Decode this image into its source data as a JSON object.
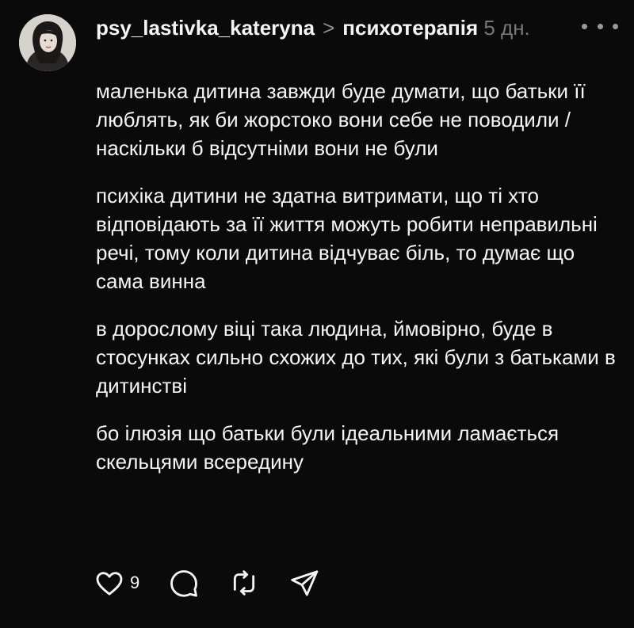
{
  "post": {
    "username": "psy_lastivka_kateryna",
    "separator": ">",
    "topic": "психотерапія",
    "time": "5 дн.",
    "paragraphs": [
      "маленька дитина завжди буде думати, що батьки її люблять, як би жорстоко вони себе не поводили / наскільки б відсутніми вони не були",
      "психіка дитини не здатна витримати, що ті хто відповідають за її життя можуть робити неправильні речі, тому коли дитина відчуває біль, то думає що сама винна",
      "в дорослому віці така людина, ймовірно, буде в стосунках сильно схожих до тих, які були з батьками в дитинстві",
      "бо ілюзія що батьки були ідеальними ламається скельцями всередину"
    ],
    "like_count": "9"
  },
  "icons": {
    "avatar": "profile-photo",
    "more": "more-horizontal-icon",
    "like": "heart-icon",
    "reply": "comment-bubble-icon",
    "repost": "repost-icon",
    "share": "send-icon"
  },
  "colors": {
    "background": "#0a0a0a",
    "text": "#f3f5f7",
    "secondary": "#777777"
  }
}
